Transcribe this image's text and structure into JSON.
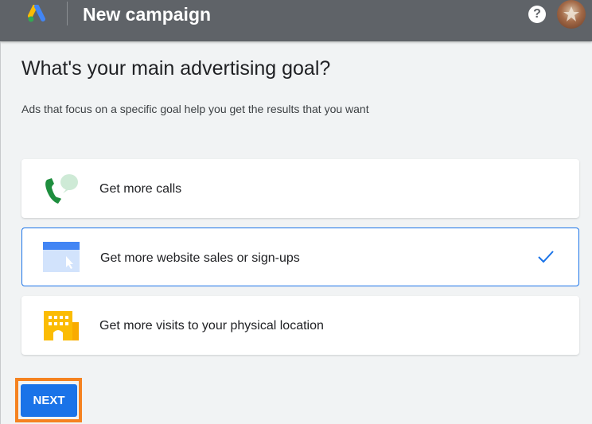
{
  "header": {
    "title": "New campaign",
    "logo_icon": "google-ads-logo-icon",
    "help_icon": "help-circle-icon",
    "help_glyph": "?",
    "avatar_icon": "user-avatar"
  },
  "main": {
    "heading": "What's your main advertising goal?",
    "subtext": "Ads that focus on a specific goal help you get the results that you want",
    "goals": [
      {
        "label": "Get more calls",
        "icon": "phone-call-icon",
        "selected": false
      },
      {
        "label": "Get more website sales or sign-ups",
        "icon": "website-cursor-icon",
        "selected": true
      },
      {
        "label": "Get more visits to your physical location",
        "icon": "store-building-icon",
        "selected": false
      }
    ],
    "next_label": "NEXT"
  },
  "colors": {
    "topbar": "#5f6368",
    "accent": "#1a73e8",
    "highlight": "#f58220",
    "page_bg": "#f1f3f4"
  }
}
